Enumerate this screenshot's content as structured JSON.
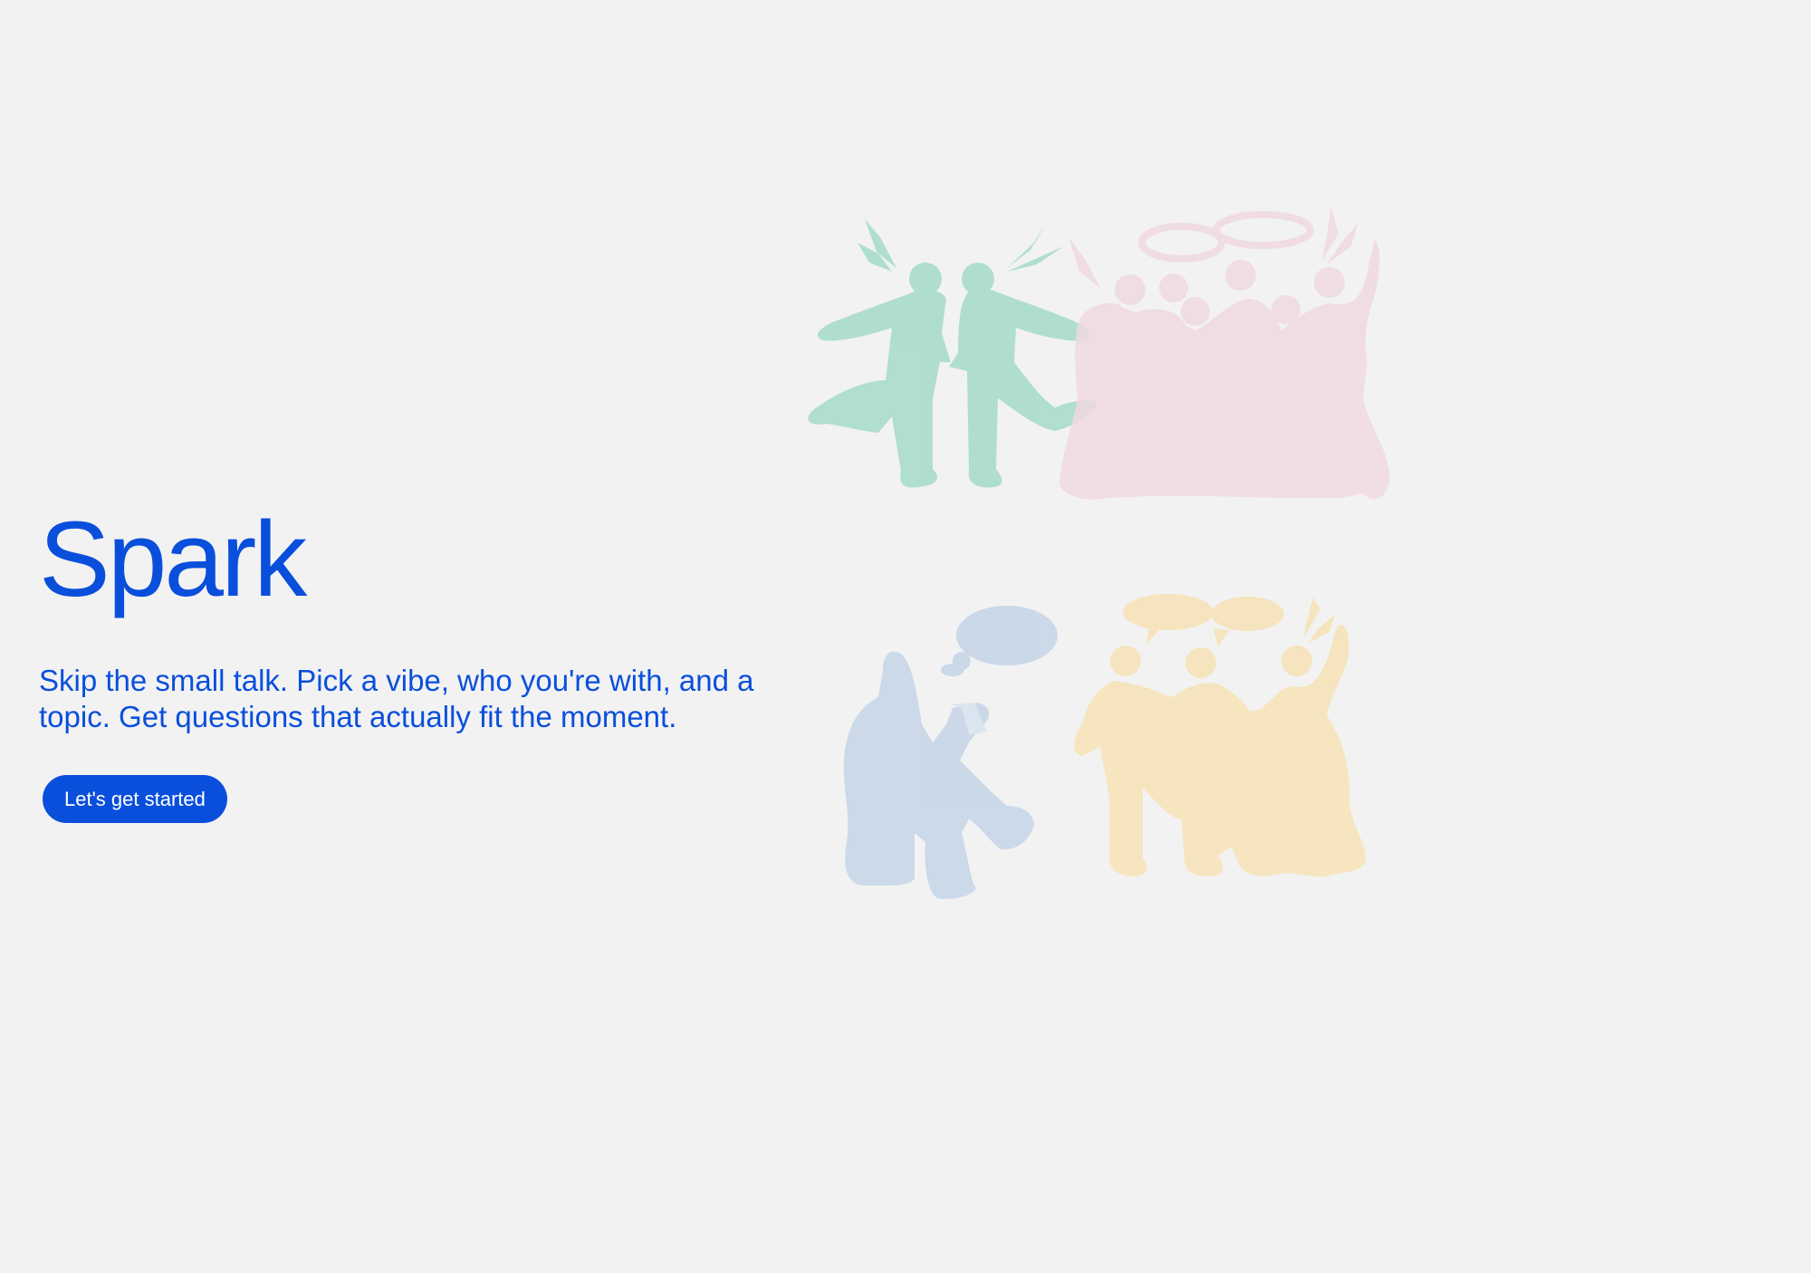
{
  "hero": {
    "title": "Spark",
    "tagline": "Skip the small talk. Pick a vibe, who you're with, and a topic. Get questions that actually fit the moment.",
    "cta_label": "Let's get started"
  },
  "illustrations": [
    {
      "name": "dancing-pair-illustration",
      "color": "#a9dccb"
    },
    {
      "name": "crowd-illustration",
      "color": "#f0d9e3"
    },
    {
      "name": "reading-person-illustration",
      "color": "#c6d6e8"
    },
    {
      "name": "chatting-group-illustration",
      "color": "#f6e3b8"
    }
  ],
  "colors": {
    "background": "#f2f2f2",
    "accent": "#0a4fdc"
  }
}
